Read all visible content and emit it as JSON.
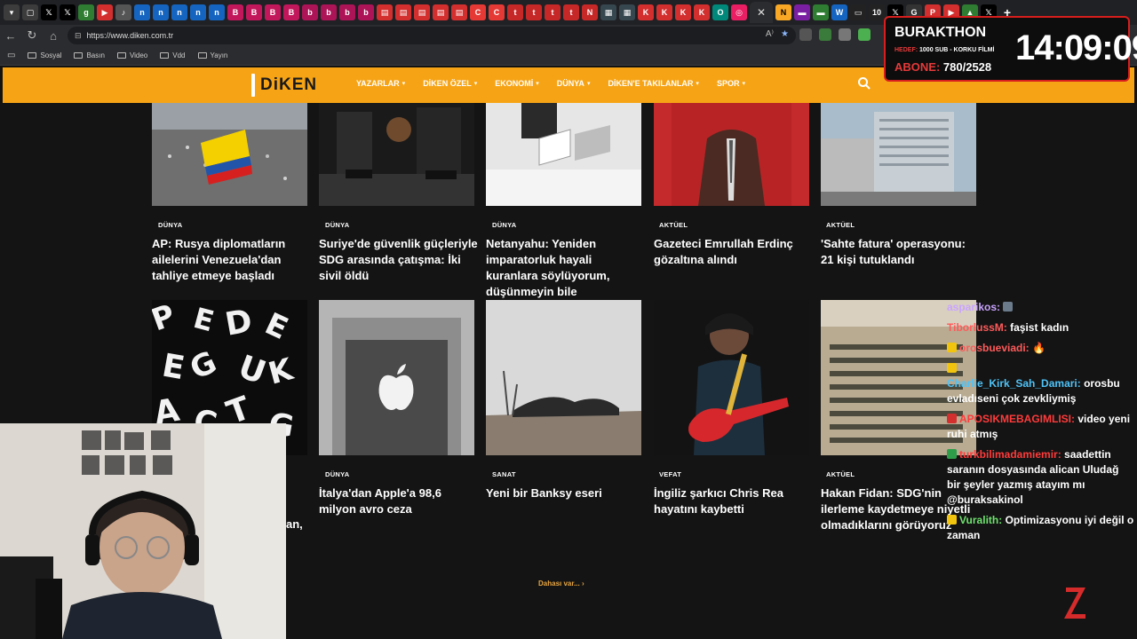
{
  "browser": {
    "url": "https://www.diken.com.tr",
    "bookmarks": [
      "Sosyal",
      "Basın",
      "Video",
      "Vdd",
      "Yayın"
    ]
  },
  "site": {
    "logo_text": "DiKEN",
    "nav_items": [
      "YAZARLAR",
      "DİKEN ÖZEL",
      "EKONOMİ",
      "DÜNYA",
      "DİKEN'E TAKILANLAR",
      "SPOR"
    ],
    "more_label": "Dahası var..."
  },
  "articles_row1": [
    {
      "category": "DÜNYA",
      "title": "AP: Rusya diplomatların ailelerini Venezuela'dan tahliye etmeye başladı"
    },
    {
      "category": "DÜNYA",
      "title": "Suriye'de güvenlik güçleriyle SDG arasında çatışma: İki sivil öldü"
    },
    {
      "category": "DÜNYA",
      "title": "Netanyahu: Yeniden imparatorluk hayali kuranlara söylüyorum, düşünmeyin bile"
    },
    {
      "category": "AKTÜEL",
      "title": "Gazeteci Emrullah Erdinç gözaltına alındı"
    },
    {
      "category": "AKTÜEL",
      "title": "'Sahte fatura' operasyonu: 21 kişi tutuklandı"
    }
  ],
  "articles_row2": [
    {
      "category": "",
      "title": "an,"
    },
    {
      "category": "DÜNYA",
      "title": "İtalya'dan Apple'a 98,6 milyon avro ceza"
    },
    {
      "category": "SANAT",
      "title": "Yeni bir Banksy eseri"
    },
    {
      "category": "VEFAT",
      "title": "İngiliz şarkıcı Chris Rea hayatını kaybetti"
    },
    {
      "category": "AKTÜEL",
      "title": "Hakan Fidan: SDG'nin ilerleme kaydetmeye niyetli olmadıklarını görüyoruz"
    }
  ],
  "timer": {
    "title": "BURAKTHON",
    "sub_label": "HEDEF:",
    "sub_text": "1000 SUB - KORKU FİLMİ",
    "abone_label": "ABONE:",
    "abone_value": "780/2528",
    "clock": "14:09:09"
  },
  "chat": [
    {
      "user": "asparikos:",
      "message": "",
      "color": "#c9a3ff"
    },
    {
      "user": "TiborlussM:",
      "message": "faşist kadın",
      "color": "#ff5a5a"
    },
    {
      "user": "orosbueviadi:",
      "message": "",
      "color": "#ff5a5a"
    },
    {
      "user": "Charlie_Kirk_Sah_Damari:",
      "message": "orosbu evladıseni çok zevkliymiş",
      "color": "#4fc3f7"
    },
    {
      "user": "APOSIKMEBAGIMLISI:",
      "message": "video yeni ruhi atmış",
      "color": "#ff3b3b"
    },
    {
      "user": "turkbilimadamiemir:",
      "message": "saadettin saranın dosyasında alican Uludağ bir şeyler yazmış atayım mı @buraksakinol",
      "color": "#ff3b3b"
    },
    {
      "user": "Vuralith:",
      "message": "Optimizasyonu iyi değil o zaman",
      "color": "#6ee26e"
    }
  ],
  "colors": {
    "nav_bg": "#f6a416",
    "timer_border": "#d81e1e",
    "more_link": "#e8a640"
  }
}
